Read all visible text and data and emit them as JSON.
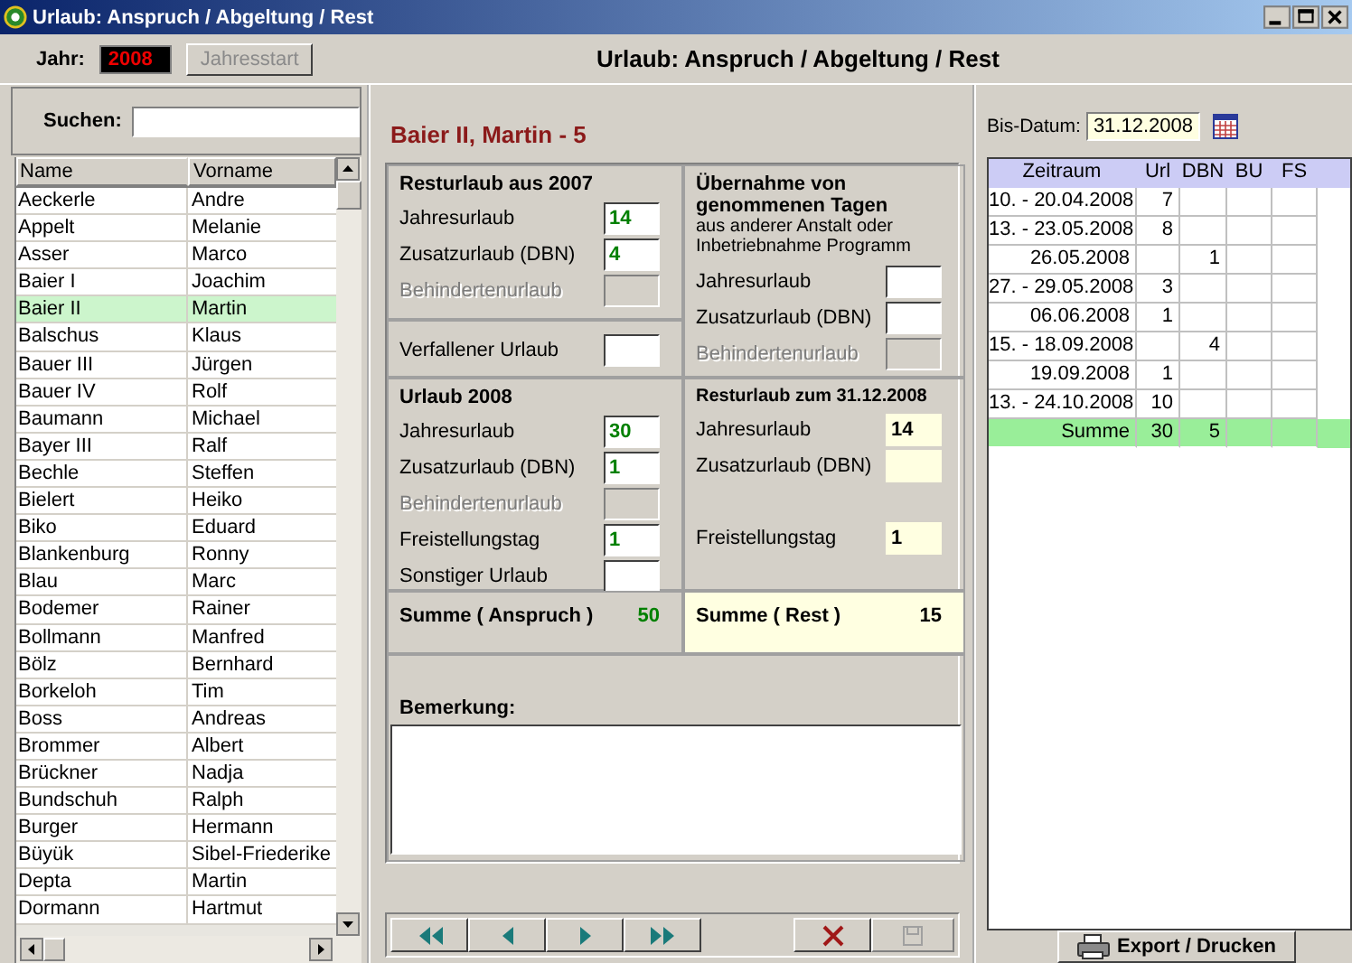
{
  "window": {
    "title": "Urlaub: Anspruch / Abgeltung / Rest"
  },
  "year": {
    "label": "Jahr:",
    "value": "2008"
  },
  "start_button": {
    "label": "Jahresstart",
    "disabled": true
  },
  "header": "Urlaub: Anspruch / Abgeltung / Rest",
  "search": {
    "label": "Suchen:"
  },
  "employees": {
    "columns": [
      "Name",
      "Vorname"
    ],
    "rows": [
      {
        "name": "Aeckerle",
        "first_name": "Andre",
        "selected": false
      },
      {
        "name": "Appelt",
        "first_name": "Melanie",
        "selected": false
      },
      {
        "name": "Asser",
        "first_name": "Marco",
        "selected": false
      },
      {
        "name": "Baier I",
        "first_name": "Joachim",
        "selected": false
      },
      {
        "name": "Baier II",
        "first_name": "Martin",
        "selected": true
      },
      {
        "name": "Balschus",
        "first_name": "Klaus",
        "selected": false
      },
      {
        "name": "Bauer III",
        "first_name": "Jürgen",
        "selected": false
      },
      {
        "name": "Bauer IV",
        "first_name": "Rolf",
        "selected": false
      },
      {
        "name": "Baumann",
        "first_name": "Michael",
        "selected": false
      },
      {
        "name": "Bayer III",
        "first_name": "Ralf",
        "selected": false
      },
      {
        "name": "Bechle",
        "first_name": "Steffen",
        "selected": false
      },
      {
        "name": "Bielert",
        "first_name": "Heiko",
        "selected": false
      },
      {
        "name": "Biko",
        "first_name": "Eduard",
        "selected": false
      },
      {
        "name": "Blankenburg",
        "first_name": "Ronny",
        "selected": false
      },
      {
        "name": "Blau",
        "first_name": "Marc",
        "selected": false
      },
      {
        "name": "Bodemer",
        "first_name": "Rainer",
        "selected": false
      },
      {
        "name": "Bollmann",
        "first_name": "Manfred",
        "selected": false
      },
      {
        "name": "Bölz",
        "first_name": "Bernhard",
        "selected": false
      },
      {
        "name": "Borkeloh",
        "first_name": "Tim",
        "selected": false
      },
      {
        "name": "Boss",
        "first_name": "Andreas",
        "selected": false
      },
      {
        "name": "Brommer",
        "first_name": "Albert",
        "selected": false
      },
      {
        "name": "Brückner",
        "first_name": "Nadja",
        "selected": false
      },
      {
        "name": "Bundschuh",
        "first_name": "Ralph",
        "selected": false
      },
      {
        "name": "Burger",
        "first_name": "Hermann",
        "selected": false
      },
      {
        "name": "Büyük",
        "first_name": "Sibel-Friederike",
        "selected": false
      },
      {
        "name": "Depta",
        "first_name": "Martin",
        "selected": false
      },
      {
        "name": "Dormann",
        "first_name": "Hartmut",
        "selected": false
      }
    ]
  },
  "employee_title": "Baier II, Martin - 5",
  "resturlaub_2007": {
    "title": "Resturlaub aus 2007",
    "fields": [
      {
        "label": "Jahresurlaub",
        "value": "14",
        "disabled": false
      },
      {
        "label": "Zusatzurlaub (DBN)",
        "value": "4",
        "disabled": false
      },
      {
        "label": "Behindertenurlaub",
        "disabled": true
      }
    ]
  },
  "verfallen": {
    "fields": [
      {
        "label": "Verfallener Urlaub",
        "disabled": false
      }
    ]
  },
  "uebernahme": {
    "title": "Übernahme von genommenen Tagen",
    "note": "aus anderer Anstalt oder Inbetriebnahme Programm",
    "fields": [
      {
        "label": "Jahresurlaub",
        "disabled": false
      },
      {
        "label": "Zusatzurlaub (DBN)",
        "disabled": false
      },
      {
        "label": "Behindertenurlaub",
        "disabled": true
      }
    ]
  },
  "urlaub_2008": {
    "title": "Urlaub 2008",
    "fields": [
      {
        "label": "Jahresurlaub",
        "value": "30",
        "disabled": false
      },
      {
        "label": "Zusatzurlaub (DBN)",
        "value": "1",
        "disabled": false
      },
      {
        "label": "Behindertenurlaub",
        "disabled": true
      },
      {
        "label": "Freistellungstag",
        "value": "1",
        "disabled": false
      },
      {
        "label": "Sonstiger Urlaub",
        "disabled": false
      }
    ]
  },
  "resturlaub_ende": {
    "title": "Resturlaub zum 31.12.2008",
    "kind": "readonly",
    "fields": [
      {
        "label": "Jahresurlaub",
        "value": "14",
        "disabled": false
      },
      {
        "label": "Zusatzurlaub (DBN)",
        "disabled": false
      },
      {
        "label": "Freistellungstag",
        "value": "1",
        "disabled": false
      }
    ]
  },
  "sums": [
    {
      "label": "Summe ( Anspruch )",
      "value": "50",
      "kind": "entitlement"
    },
    {
      "label": "Summe ( Rest )",
      "value": "15",
      "kind": "rest"
    }
  ],
  "remark": {
    "label": "Bemerkung:"
  },
  "nav_buttons": [
    {
      "kind": "first",
      "disabled": false
    },
    {
      "kind": "prev",
      "disabled": false
    },
    {
      "kind": "next",
      "disabled": false
    },
    {
      "kind": "last",
      "disabled": false
    },
    {
      "kind": "delete",
      "disabled": false
    },
    {
      "kind": "save",
      "disabled": true
    }
  ],
  "date_filter": {
    "label": "Bis-Datum:",
    "value": "31.12.2008"
  },
  "periods": {
    "columns": [
      "Zeitraum",
      "Url",
      "DBN",
      "BU",
      "FS"
    ],
    "rows": [
      {
        "cells": [
          "10. - 20.04.2008",
          "7",
          null,
          null,
          null
        ]
      },
      {
        "cells": [
          "13. - 23.05.2008",
          "8",
          null,
          null,
          null
        ]
      },
      {
        "cells": [
          "26.05.2008",
          null,
          "1",
          null,
          null
        ]
      },
      {
        "cells": [
          "27. - 29.05.2008",
          "3",
          null,
          null,
          null
        ]
      },
      {
        "cells": [
          "06.06.2008",
          "1",
          null,
          null,
          null
        ]
      },
      {
        "cells": [
          "15. - 18.09.2008",
          null,
          "4",
          null,
          null
        ]
      },
      {
        "cells": [
          "19.09.2008",
          "1",
          null,
          null,
          null
        ]
      },
      {
        "cells": [
          "13. - 24.10.2008",
          "10",
          null,
          null,
          null
        ]
      }
    ],
    "total": {
      "cells": [
        "Summe",
        "30",
        "5",
        null,
        null
      ]
    }
  },
  "export_button": {
    "label": "Export / Drucken"
  }
}
